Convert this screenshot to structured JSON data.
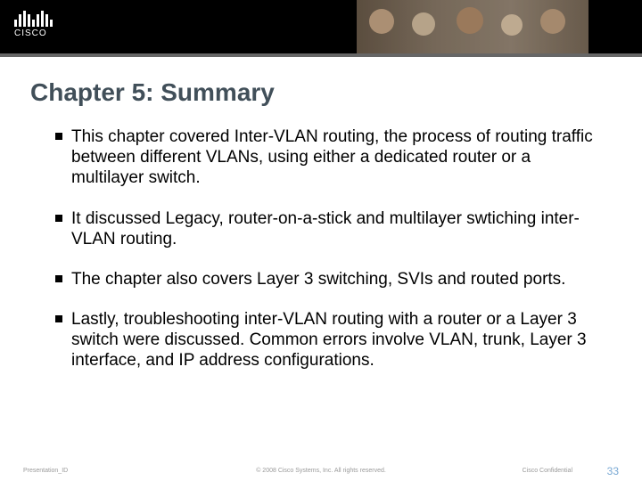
{
  "logo_text": "CISCO",
  "title": "Chapter 5: Summary",
  "bullets": [
    "This chapter covered Inter-VLAN routing, the process of routing traffic between different VLANs, using either a dedicated router or a multilayer switch.",
    "It discussed Legacy, router-on-a-stick and multilayer swtiching inter-VLAN routing.",
    "The chapter also covers Layer 3 switching, SVIs and routed ports.",
    "Lastly, troubleshooting inter-VLAN routing with a router or a Layer 3 switch were discussed. Common errors involve VLAN, trunk, Layer 3 interface, and IP address configurations."
  ],
  "footer": {
    "presentation_id": "Presentation_ID",
    "copyright": "© 2008 Cisco Systems, Inc. All rights reserved.",
    "confidential": "Cisco Confidential",
    "page_number": "33"
  }
}
